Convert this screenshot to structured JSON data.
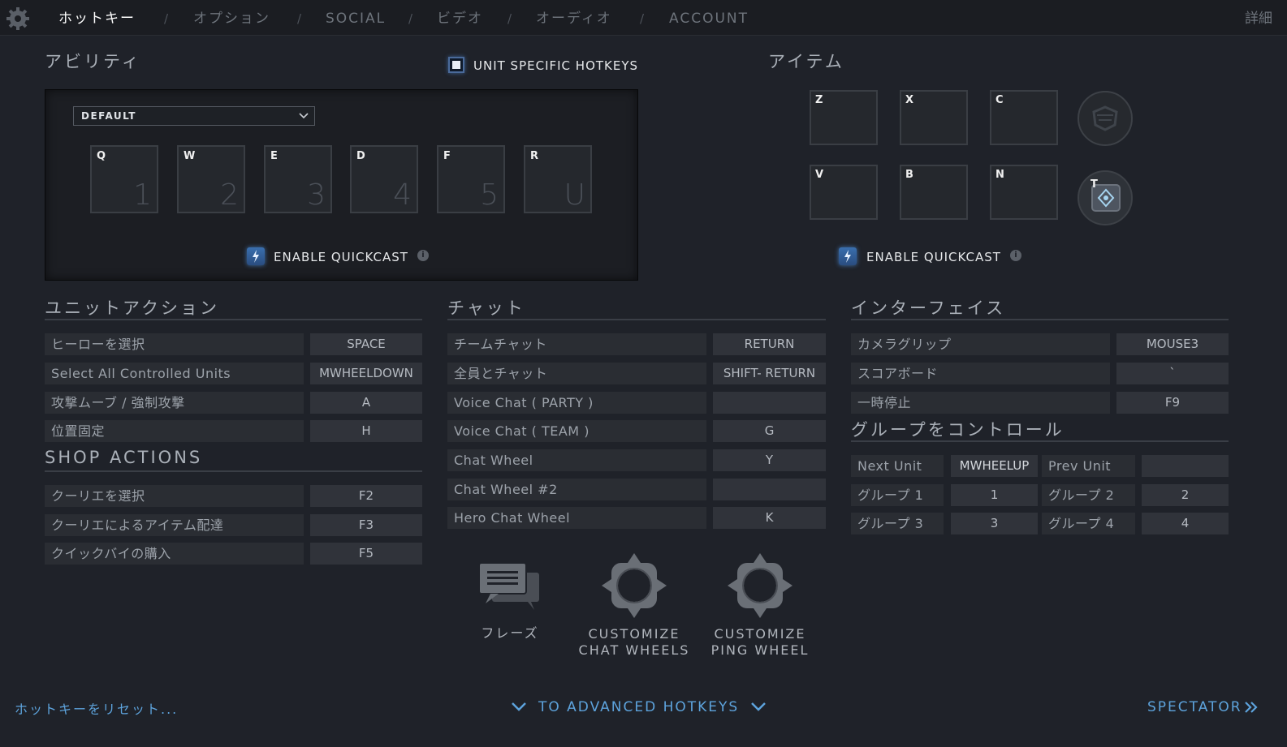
{
  "tabs": [
    {
      "label": "ホットキー",
      "active": true
    },
    {
      "label": "オプション",
      "active": false
    },
    {
      "label": "SOCIAL",
      "active": false
    },
    {
      "label": "ビデオ",
      "active": false
    },
    {
      "label": "オーディオ",
      "active": false
    },
    {
      "label": "ACCOUNT",
      "active": false
    }
  ],
  "tab_separator": "/",
  "detail_label": "詳細",
  "abilities": {
    "title": "アビリティ",
    "unit_specific_label": "UNIT SPECIFIC HOTKEYS",
    "unit_specific_checked": true,
    "preset": "DEFAULT",
    "slots": [
      {
        "key": "Q",
        "num": "1"
      },
      {
        "key": "W",
        "num": "2"
      },
      {
        "key": "E",
        "num": "3"
      },
      {
        "key": "D",
        "num": "4"
      },
      {
        "key": "F",
        "num": "5"
      },
      {
        "key": "R",
        "num": "U"
      }
    ],
    "quickcast_label": "ENABLE QUICKCAST",
    "info_glyph": "i"
  },
  "items": {
    "title": "アイテム",
    "slots": [
      "Z",
      "X",
      "C",
      "V",
      "B",
      "N"
    ],
    "tp_key": "T",
    "quickcast_label": "ENABLE QUICKCAST",
    "info_glyph": "i"
  },
  "unit_actions": {
    "title": "ユニットアクション",
    "rows": [
      {
        "label": "ヒーローを選択",
        "key": "SPACE"
      },
      {
        "label": "Select All Controlled Units",
        "key": "MWHEELDOWN"
      },
      {
        "label": "攻撃ムーブ / 強制攻撃",
        "key": "A"
      },
      {
        "label": "位置固定",
        "key": "H"
      }
    ]
  },
  "shop_actions": {
    "title": "SHOP ACTIONS",
    "rows": [
      {
        "label": "クーリエを選択",
        "key": "F2"
      },
      {
        "label": "クーリエによるアイテム配達",
        "key": "F3"
      },
      {
        "label": "クイックバイの購入",
        "key": "F5"
      }
    ]
  },
  "chat": {
    "title": "チャット",
    "rows": [
      {
        "label": "チームチャット",
        "key": "RETURN"
      },
      {
        "label": "全員とチャット",
        "key": "SHIFT- RETURN"
      },
      {
        "label": "Voice Chat ( PARTY )",
        "key": ""
      },
      {
        "label": "Voice Chat ( TEAM )",
        "key": "G"
      },
      {
        "label": "Chat Wheel",
        "key": "Y"
      },
      {
        "label": "Chat Wheel #2",
        "key": ""
      },
      {
        "label": "Hero Chat Wheel",
        "key": "K"
      }
    ],
    "phrases_label": "フレーズ",
    "customize_chat_line1": "CUSTOMIZE",
    "customize_chat_line2": "CHAT WHEELS",
    "customize_ping_line1": "CUSTOMIZE",
    "customize_ping_line2": "PING WHEEL"
  },
  "interface": {
    "title": "インターフェイス",
    "rows": [
      {
        "label": "カメラグリップ",
        "key": "MOUSE3"
      },
      {
        "label": "スコアボード",
        "key": "`"
      },
      {
        "label": "一時停止",
        "key": "F9"
      }
    ]
  },
  "group_control": {
    "title": "グループをコントロール",
    "rows": [
      [
        {
          "label": "Next Unit",
          "key": "MWHEELUP"
        },
        {
          "label": "Prev Unit",
          "key": ""
        }
      ],
      [
        {
          "label": "グループ 1",
          "key": "1"
        },
        {
          "label": "グループ 2",
          "key": "2"
        }
      ],
      [
        {
          "label": "グループ 3",
          "key": "3"
        },
        {
          "label": "グループ 4",
          "key": "4"
        }
      ]
    ]
  },
  "footer": {
    "reset_label": "ホットキーをリセット...",
    "advanced_label": "TO ADVANCED HOTKEYS",
    "spectator_label": "SPECTATOR"
  },
  "colors": {
    "background": "#1f2229",
    "accent_blue": "#5da3dc",
    "active_tab": "#ffffff"
  }
}
